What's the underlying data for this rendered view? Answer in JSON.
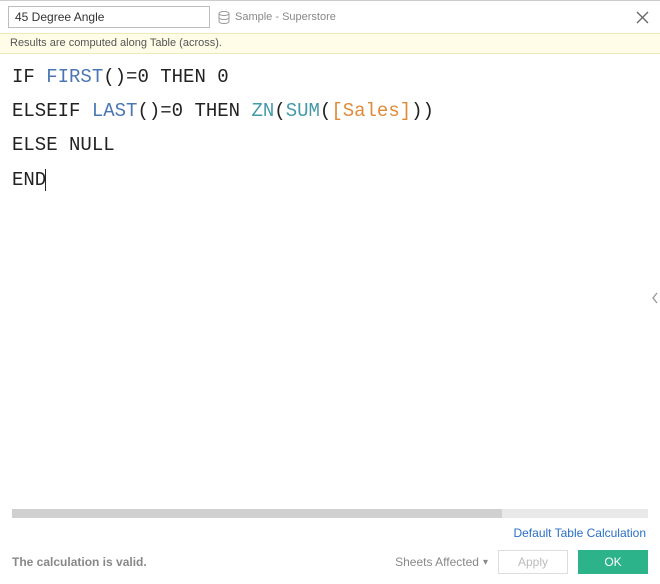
{
  "header": {
    "name_value": "45 Degree Angle",
    "datasource_label": "Sample - Superstore"
  },
  "info_bar": "Results are computed along Table (across).",
  "editor": {
    "tokens": [
      {
        "t": "IF ",
        "c": "kw"
      },
      {
        "t": "FIRST",
        "c": "fn-blue"
      },
      {
        "t": "()=0 ",
        "c": "kw"
      },
      {
        "t": "THEN",
        "c": "kw"
      },
      {
        "t": " 0",
        "c": "kw"
      },
      {
        "t": "\n",
        "c": ""
      },
      {
        "t": "ELSEIF ",
        "c": "kw"
      },
      {
        "t": "LAST",
        "c": "fn-blue"
      },
      {
        "t": "()=0 ",
        "c": "kw"
      },
      {
        "t": "THEN ",
        "c": "kw"
      },
      {
        "t": "ZN",
        "c": "fn-teal"
      },
      {
        "t": "(",
        "c": "kw"
      },
      {
        "t": "SUM",
        "c": "fn-teal"
      },
      {
        "t": "(",
        "c": "kw"
      },
      {
        "t": "[Sales]",
        "c": "field"
      },
      {
        "t": "))",
        "c": "kw"
      },
      {
        "t": "\n",
        "c": ""
      },
      {
        "t": "ELSE NULL",
        "c": "kw"
      },
      {
        "t": "\n",
        "c": ""
      },
      {
        "t": "END",
        "c": "kw"
      }
    ]
  },
  "link_default_calc": "Default Table Calculation",
  "footer": {
    "status": "The calculation is valid.",
    "sheets_affected": "Sheets Affected",
    "apply": "Apply",
    "ok": "OK"
  }
}
